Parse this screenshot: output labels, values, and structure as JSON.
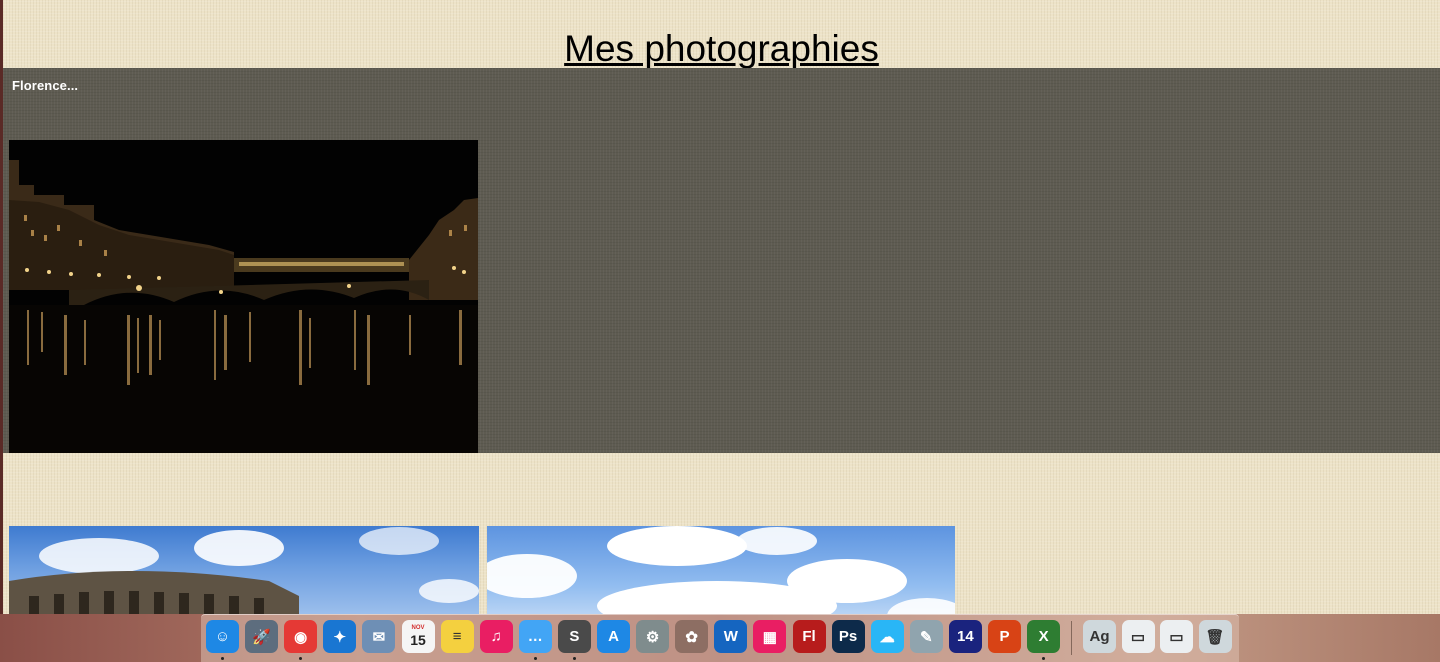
{
  "page": {
    "title": "Mes photographies",
    "album": {
      "label": "Florence..."
    }
  },
  "photos": [
    {
      "name": "Florence night bridge"
    },
    {
      "name": "Colosseum"
    },
    {
      "name": "Clouds sky"
    }
  ],
  "dock": {
    "calendar_date": "15",
    "calendar_month": "NOV",
    "items": [
      {
        "name": "finder-icon",
        "glyph": "☺",
        "color": "#1e88e5"
      },
      {
        "name": "launchpad-icon",
        "glyph": "🚀",
        "color": "#5d6d7e"
      },
      {
        "name": "chrome-icon",
        "glyph": "◉",
        "color": "#e53935"
      },
      {
        "name": "safari-icon",
        "glyph": "✦",
        "color": "#1976d2"
      },
      {
        "name": "mail-icon",
        "glyph": "✉",
        "color": "#6e8fb5"
      },
      {
        "name": "calendar-icon",
        "glyph": "",
        "color": "#f5f5f5"
      },
      {
        "name": "notes-icon",
        "glyph": "≡",
        "color": "#f4d03f"
      },
      {
        "name": "itunes-icon",
        "glyph": "♫",
        "color": "#e91e63"
      },
      {
        "name": "messages-icon",
        "glyph": "…",
        "color": "#42a5f5"
      },
      {
        "name": "sublime-text-icon",
        "glyph": "S",
        "color": "#4a4a4a"
      },
      {
        "name": "app-store-icon",
        "glyph": "A",
        "color": "#1e88e5"
      },
      {
        "name": "system-preferences-icon",
        "glyph": "⚙",
        "color": "#7f8c8d"
      },
      {
        "name": "installer-icon",
        "glyph": "✿",
        "color": "#8d6e63"
      },
      {
        "name": "word-icon",
        "glyph": "W",
        "color": "#1565c0"
      },
      {
        "name": "mosaic-icon",
        "glyph": "▦",
        "color": "#e91e63"
      },
      {
        "name": "flash-icon",
        "glyph": "Fl",
        "color": "#b71c1c"
      },
      {
        "name": "photoshop-icon",
        "glyph": "Ps",
        "color": "#0d2a4a"
      },
      {
        "name": "cloud-app-icon",
        "glyph": "☁",
        "color": "#29b6f6"
      },
      {
        "name": "preview-icon",
        "glyph": "✎",
        "color": "#90a4ae"
      },
      {
        "name": "i14-icon",
        "glyph": "14",
        "color": "#1a237e"
      },
      {
        "name": "powerpoint-icon",
        "glyph": "P",
        "color": "#d84315"
      },
      {
        "name": "excel-icon",
        "glyph": "X",
        "color": "#2e7d32"
      },
      {
        "name": "font-book-icon",
        "glyph": "Ag",
        "color": "#cfd8dc"
      },
      {
        "name": "document-icon",
        "glyph": "▭",
        "color": "#eceff1"
      },
      {
        "name": "downloads-icon",
        "glyph": "▭",
        "color": "#eceff1"
      },
      {
        "name": "trash-icon",
        "glyph": "🗑",
        "color": "#cfd8dc"
      }
    ]
  }
}
